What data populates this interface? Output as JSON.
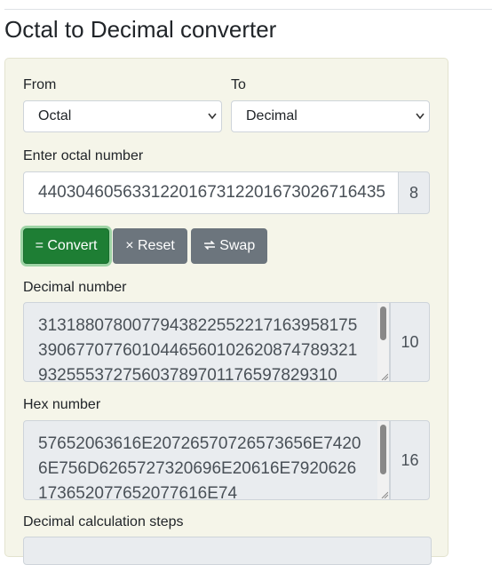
{
  "page": {
    "title": "Octal to Decimal converter"
  },
  "from": {
    "label": "From",
    "selected": "Octal"
  },
  "to": {
    "label": "To",
    "selected": "Decimal"
  },
  "octal_input": {
    "label": "Enter octal number",
    "value": "4403046056331220167312201673026716435",
    "base": "8"
  },
  "buttons": {
    "convert": "Convert",
    "reset": "Reset",
    "swap": "Swap"
  },
  "decimal_output": {
    "label": "Decimal number",
    "value": "3131880780077943822552217163958175390677077601044656010262087478932193255537275603789701176597829310",
    "base": "10"
  },
  "hex_output": {
    "label": "Hex number",
    "value": "57652063616E20726570726573656E74206E756D6265727320696E20616E7920626173652077652077616E74",
    "base": "16"
  },
  "steps": {
    "label": "Decimal calculation steps"
  }
}
